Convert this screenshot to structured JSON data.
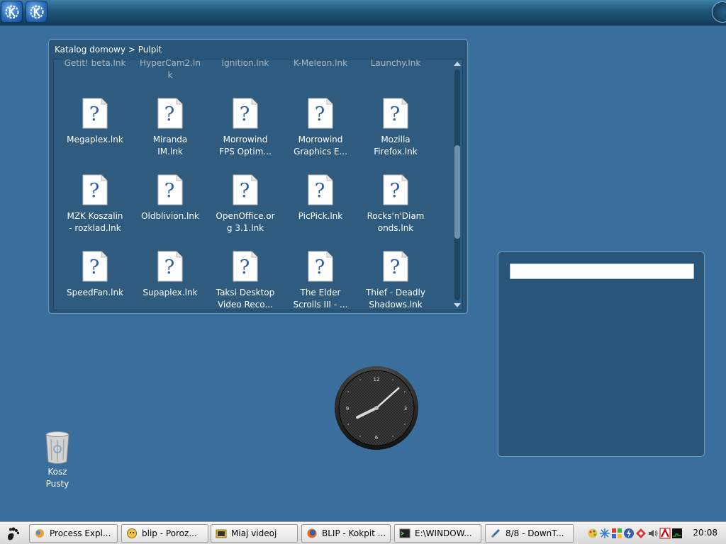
{
  "top_panel": {
    "launchers": [
      {
        "icon": "kde-logo-icon"
      },
      {
        "icon": "kde-logo-icon"
      }
    ]
  },
  "folder_view": {
    "breadcrumb": "Katalog domowy > Pulpit",
    "rows": [
      {
        "faded": true,
        "items": [
          {
            "label": "Getit! beta.lnk"
          },
          {
            "label": "HyperCam2.ln\nk"
          },
          {
            "label": "Ignition.lnk"
          },
          {
            "label": "K-Meleon.lnk"
          },
          {
            "label": "Launchy.lnk"
          }
        ]
      },
      {
        "items": [
          {
            "label": "Megaplex.lnk"
          },
          {
            "label": "Miranda\nIM.lnk"
          },
          {
            "label": "Morrowind\nFPS Optim..."
          },
          {
            "label": "Morrowind\nGraphics E..."
          },
          {
            "label": "Mozilla\nFirefox.lnk"
          }
        ]
      },
      {
        "items": [
          {
            "label": "MZK Koszalin\n- rozklad.lnk"
          },
          {
            "label": "Oldblivion.lnk"
          },
          {
            "label": "OpenOffice.or\ng 3.1.lnk"
          },
          {
            "label": "PicPick.lnk"
          },
          {
            "label": "Rocks'n'Diam\nonds.lnk"
          }
        ]
      },
      {
        "items": [
          {
            "label": "SpeedFan.lnk"
          },
          {
            "label": "Supaplex.lnk"
          },
          {
            "label": "Taksi Desktop\nVideo Reco..."
          },
          {
            "label": "The Elder\nScrolls III - ..."
          },
          {
            "label": "Thief - Deadly\nShadows.lnk"
          }
        ]
      }
    ],
    "scroll_position": 0.55
  },
  "widget": {
    "input_value": "",
    "input_placeholder": ""
  },
  "clock_widget": {
    "time": "20:08",
    "numerals": [
      "12",
      "3",
      "6",
      "9"
    ]
  },
  "trash": {
    "label": "Kosz\nPusty"
  },
  "taskbar": {
    "tasks": [
      {
        "label": "Process Expl...",
        "icon": "process-explorer-icon"
      },
      {
        "label": "blip - Poroz...",
        "icon": "messenger-icon"
      },
      {
        "label": "Miaj videoj",
        "icon": "folder-film-icon"
      },
      {
        "label": "BLIP - Kokpit ...",
        "icon": "firefox-icon"
      },
      {
        "label": "E:\\WINDOW...",
        "icon": "console-icon"
      },
      {
        "label": "8/8 - DownT...",
        "icon": "download-icon"
      }
    ],
    "tray_icons": [
      "palette-icon",
      "snowflake-icon",
      "grid-icon",
      "lightning-icon",
      "shield-icon",
      "speaker-icon",
      "antivirus-icon",
      "monitor-icon"
    ],
    "time": "20:08"
  }
}
